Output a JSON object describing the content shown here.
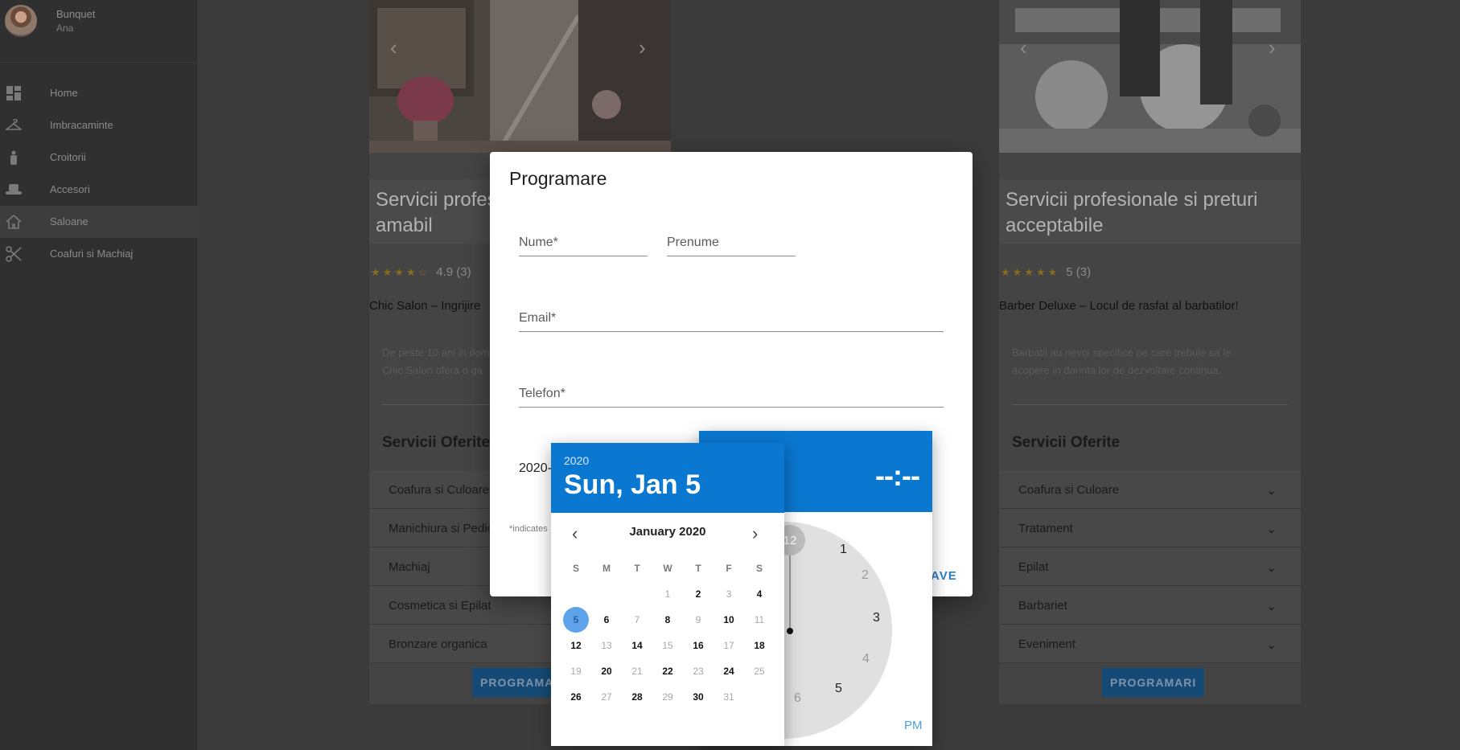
{
  "user": {
    "name": "Bunquet",
    "subname": "Ana"
  },
  "sidebar": {
    "items": [
      {
        "label": "Home"
      },
      {
        "label": "Imbracaminte"
      },
      {
        "label": "Croitorii"
      },
      {
        "label": "Accesori"
      },
      {
        "label": "Saloane"
      },
      {
        "label": "Coafuri si Machiaj"
      }
    ]
  },
  "cards": [
    {
      "caption": "Servicii profes amabil",
      "caption_line1": "Servicii profes",
      "caption_line2": "amabil",
      "rating_text": "4.9 (3)",
      "title": "Chic Salon – Ingrijire",
      "desc_line1": "De peste 10 ani in dom",
      "desc_line2": "Chic Salon ofera o ga",
      "services_title": "Servicii Oferite",
      "services": [
        "Coafura si Culoare",
        "Manichiura si Pedic",
        "Machiaj",
        "Cosmetica si Epilat",
        "Bronzare organica"
      ],
      "button": "PROGRAMARI"
    },
    {
      "caption_line1": "Servicii profesionale si preturi",
      "caption_line2": "acceptabile",
      "rating_text": "5 (3)",
      "title": "Barber Deluxe – Locul de rasfat al barbatilor!",
      "desc_line1": "Barbatii au nevoi specifice pe care trebuie sa le",
      "desc_line2": "acopere in dorinta lor de dezvoltare continua.",
      "services_title": "Servicii Oferite",
      "services": [
        "Coafura si Culoare",
        "Tratament",
        "Epilat",
        "Barbariet",
        "Eveniment"
      ],
      "button": "PROGRAMARI"
    }
  ],
  "dialog": {
    "title": "Programare",
    "fields": {
      "nume": "Nume*",
      "prenume": "Prenume",
      "email": "Email*",
      "telefon": "Telefon*",
      "date_value": "2020-"
    },
    "required_note": "*indicates",
    "save_label": "AVE"
  },
  "datepicker": {
    "year": "2020",
    "selected_label": "Sun, Jan 5",
    "month_label": "January 2020",
    "weekdays": [
      "S",
      "M",
      "T",
      "W",
      "T",
      "F",
      "S"
    ],
    "days": [
      [
        "",
        "",
        "",
        "1",
        "2",
        "3",
        "4"
      ],
      [
        "5",
        "6",
        "7",
        "8",
        "9",
        "10",
        "11"
      ],
      [
        "12",
        "13",
        "14",
        "15",
        "16",
        "17",
        "18"
      ],
      [
        "19",
        "20",
        "21",
        "22",
        "23",
        "24",
        "25"
      ],
      [
        "26",
        "27",
        "28",
        "29",
        "30",
        "31",
        ""
      ]
    ],
    "disabled_days": [
      "1",
      "3",
      "7",
      "9",
      "11",
      "13",
      "15",
      "17",
      "19",
      "21",
      "23",
      "25",
      "27",
      "29",
      "31"
    ],
    "selected_day": "5"
  },
  "timepicker": {
    "time_display": "--:--",
    "clock_numbers": {
      "n12": "12",
      "n1": "1",
      "n2": "2",
      "n3": "3",
      "n4": "4",
      "n5": "5",
      "n6": "6"
    },
    "period": "PM"
  },
  "colors": {
    "accent": "#0a77d0",
    "selected_day": "#5fa3ea",
    "save": "#2d7ec6"
  }
}
